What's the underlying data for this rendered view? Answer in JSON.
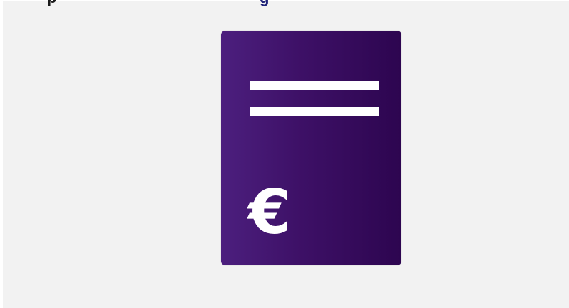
{
  "header": {
    "left_text": "p",
    "right_text": "g"
  },
  "card": {
    "currency_symbol": "€",
    "background_color": "#3d1066",
    "line_color": "#ffffff",
    "icon": "document-euro-icon"
  },
  "page": {
    "background_color": "#f2f2f2"
  }
}
